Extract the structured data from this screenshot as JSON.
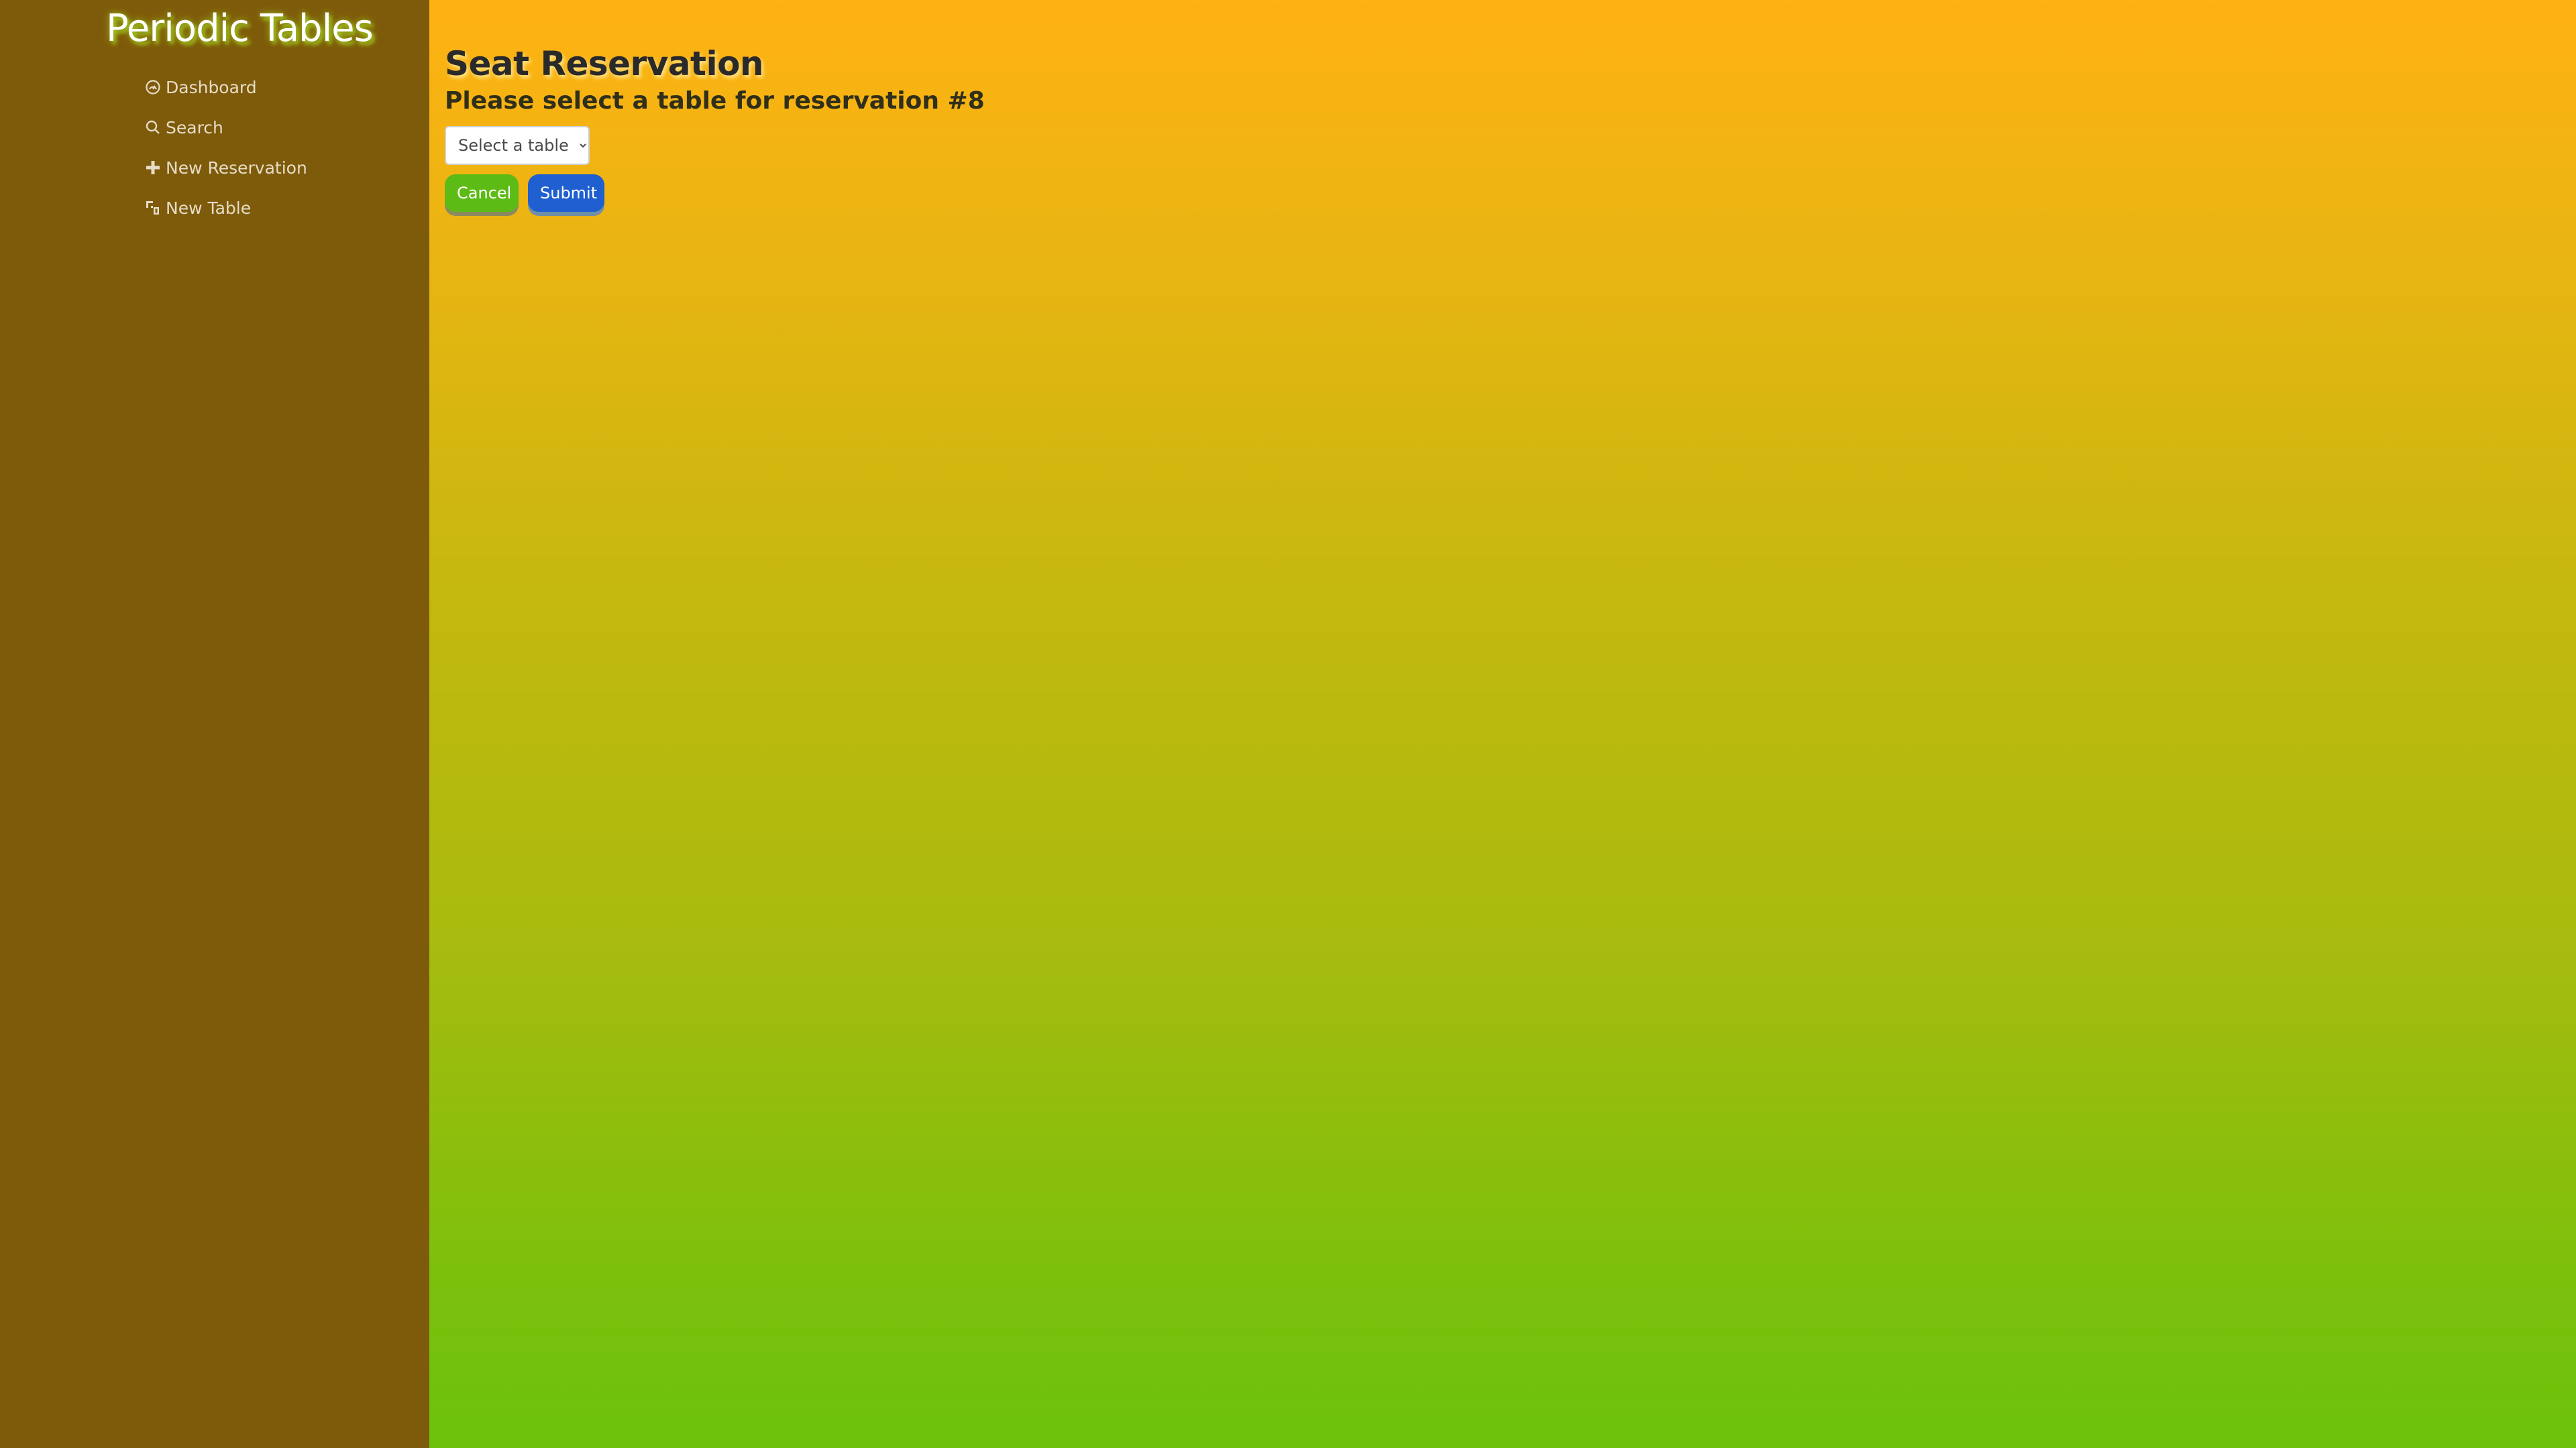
{
  "app": {
    "brand": "Periodic Tables"
  },
  "sidebar": {
    "items": [
      {
        "label": "Dashboard",
        "icon": "dashboard-icon"
      },
      {
        "label": "Search",
        "icon": "search-icon"
      },
      {
        "label": "New Reservation",
        "icon": "plus-icon"
      },
      {
        "label": "New Table",
        "icon": "table-icon"
      }
    ]
  },
  "main": {
    "title": "Seat Reservation",
    "subtitle": "Please select a table for reservation #8",
    "table_select": {
      "selected": "Select a table",
      "options": [
        "Select a table"
      ]
    },
    "cancel_label": "Cancel",
    "submit_label": "Submit"
  },
  "colors": {
    "sidebar_bg": "#7e5b0a",
    "gradient_top": "#ffb212",
    "gradient_bottom": "#6cc20a",
    "cancel_button": "#5dbb16",
    "submit_button": "#1f5fcf"
  }
}
